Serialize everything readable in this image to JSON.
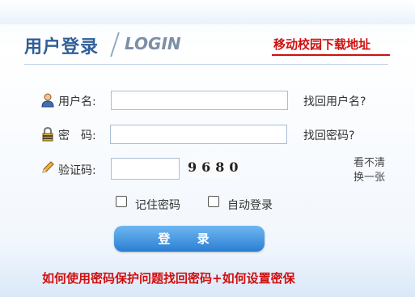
{
  "header": {
    "title_cn": "用户登录",
    "title_en": "LOGIN",
    "mobile_download": "移动校园下载地址"
  },
  "form": {
    "username_label": "用户名:",
    "password_label": "密　码:",
    "captcha_label": "验证码:",
    "captcha_value": "9680",
    "refresh_line1": "看不清",
    "refresh_line2": "换一张",
    "find_username": "找回用户名?",
    "find_password": "找回密码?",
    "remember_password": "记住密码",
    "auto_login": "自动登录",
    "username_value": "",
    "password_value": "",
    "captcha_input_value": ""
  },
  "buttons": {
    "login": "登 录"
  },
  "footer": {
    "help_link": "如何使用密码保护问题找回密码+如何设置密保"
  },
  "colors": {
    "accent_red": "#d01010",
    "title_blue": "#2f5f99",
    "button_blue": "#2a7ed3"
  },
  "icons": {
    "username": "user-icon",
    "password": "lock-icon",
    "captcha": "pencil-icon"
  }
}
